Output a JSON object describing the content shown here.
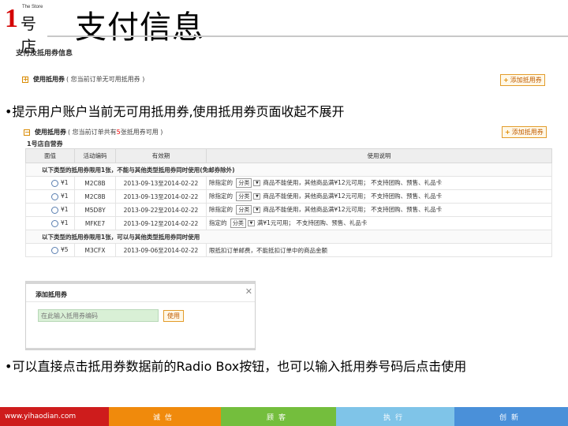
{
  "header": {
    "logo_number": "1",
    "logo_tagline": "The Store",
    "logo_store": "号店",
    "title": "支付信息"
  },
  "section_a": {
    "label": "支付及抵用券信息",
    "use_label": "使用抵用券",
    "note": "( 您当前订单无可用抵用券 )",
    "add_button": "添加抵用券"
  },
  "bullet_1": "•提示用户账户当前无可用抵用券,使用抵用券页面收起不展开",
  "section_b": {
    "use_label": "使用抵用券",
    "note_prefix": "( 您当前订单共有 ",
    "count": "5",
    "note_suffix": "张抵用券可用 )",
    "add_button": "添加抵用券",
    "store_label": "1号店自营券",
    "columns": [
      "面值",
      "活动编码",
      "有效期",
      "使用说明"
    ],
    "group_1": "以下类型的抵用券限用1张，不能与其他类型抵用券同时使用(免邮券除外)",
    "group_2": "以下类型的抵用券限用1张，可以与其他类型抵用券同时使用",
    "rows": [
      {
        "value": "¥1",
        "code": "M2C8B",
        "period": "2013-09-13至2014-02-22",
        "desc_a": "除指定的",
        "desc_sel": "分类",
        "desc_b": "商品不能使用，其他商品满¥12元可用； 不支持团购、预售、礼品卡"
      },
      {
        "value": "¥1",
        "code": "M2C8B",
        "period": "2013-09-13至2014-02-22",
        "desc_a": "除指定的",
        "desc_sel": "分类",
        "desc_b": "商品不能使用，其他商品满¥12元可用； 不支持团购、预售、礼品卡"
      },
      {
        "value": "¥1",
        "code": "M5D8Y",
        "period": "2013-09-22至2014-02-22",
        "desc_a": "除指定的",
        "desc_sel": "分类",
        "desc_b": "商品不能使用，其他商品满¥12元可用； 不支持团购、预售、礼品卡"
      },
      {
        "value": "¥1",
        "code": "MFKE7",
        "period": "2013-09-12至2014-02-22",
        "desc_a": "指定的",
        "desc_sel": "分类",
        "desc_b": "满¥1元可用； 不支持团购、预售、礼品卡"
      }
    ],
    "row_5": {
      "value": "¥5",
      "code": "M3CFX",
      "period": "2013-09-06至2014-02-22",
      "desc": "限抵扣订单邮费，不能抵扣订单中的商品金额"
    }
  },
  "popup": {
    "title": "添加抵用券",
    "placeholder": "在此输入抵用券编码",
    "use_button": "使用",
    "close": "✕"
  },
  "bullet_2": "•可以直接点击抵用券数据前的Radio Box按钮，也可以输入抵用券号码后点击使用",
  "footer": {
    "site": "www.yihaodian.com",
    "items": [
      "诚信",
      "顾客",
      "执行",
      "创新"
    ]
  }
}
